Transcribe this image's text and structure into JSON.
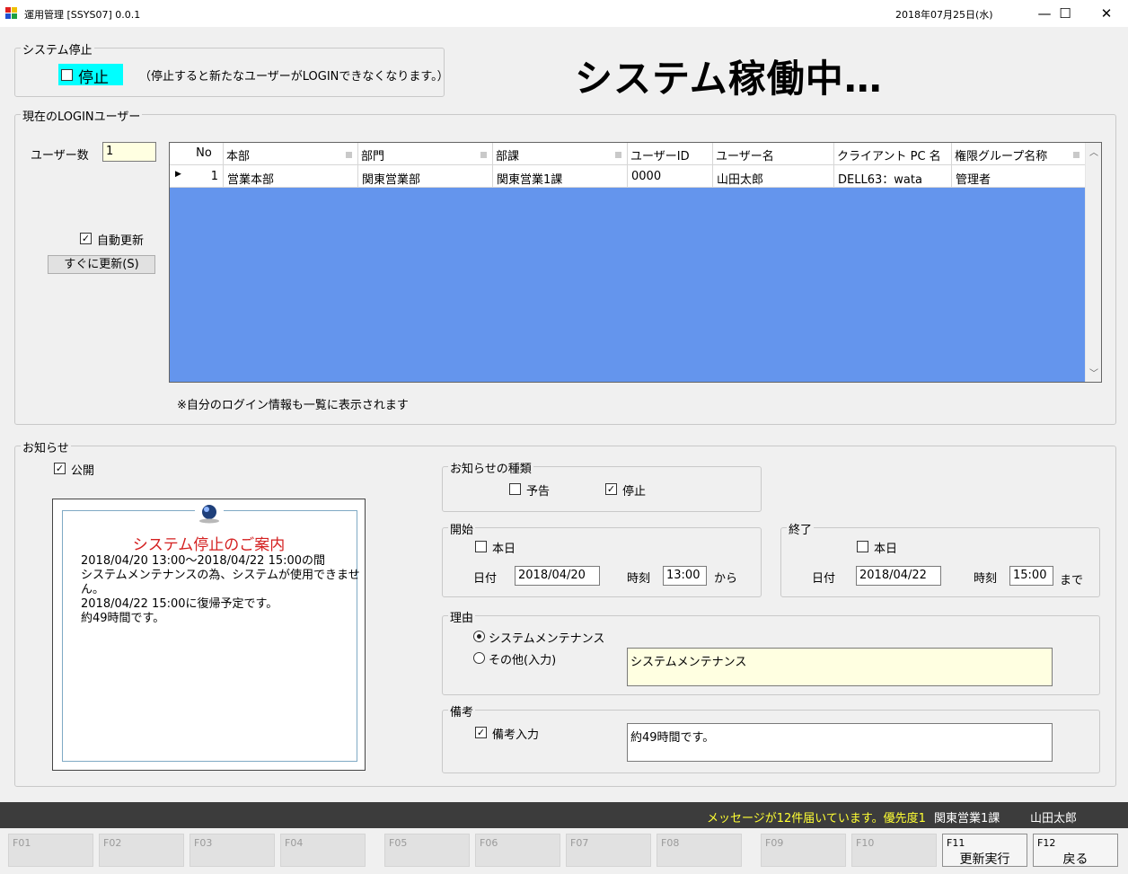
{
  "window": {
    "title": "運用管理 [SSYS07] 0.0.1",
    "date": "2018年07月25日(水)",
    "controls": {
      "minimize": "—",
      "maximize": "☐",
      "close": "✕"
    }
  },
  "system_stop": {
    "legend": "システム停止",
    "checkbox_label": "停止",
    "note": "（停止すると新たなユーザーがLOGINできなくなります。）",
    "status_banner": "システム稼働中…"
  },
  "login_users": {
    "legend": "現在のLOGINユーザー",
    "user_count_label": "ユーザー数",
    "user_count_value": "1",
    "auto_refresh_label": "自動更新",
    "refresh_button": "すぐに更新(S)",
    "columns": [
      "No",
      "本部",
      "部門",
      "部課",
      "ユーザーID",
      "ユーザー名",
      "クライアント PC 名",
      "権限グループ名称"
    ],
    "rows": [
      [
        "1",
        "営業本部",
        "関東営業部",
        "関東営業1課",
        "0000",
        "山田太郎",
        "DELL63：wata",
        "管理者"
      ]
    ],
    "footnote": "※自分のログイン情報も一覧に表示されます"
  },
  "notice": {
    "legend": "お知らせ",
    "publish_label": "公開",
    "preview": {
      "title": "システム停止のご案内",
      "lines": [
        "2018/04/20 13:00～2018/04/22 15:00の間",
        "システムメンテナンスの為、システムが使用できませ",
        "ん。",
        "2018/04/22 15:00に復帰予定です。",
        "約49時間です。"
      ]
    },
    "type": {
      "legend": "お知らせの種類",
      "advance_label": "予告",
      "stop_label": "停止"
    },
    "start": {
      "legend": "開始",
      "today_label": "本日",
      "date_label": "日付",
      "date_value": "2018/04/20",
      "time_label": "時刻",
      "time_value": "13:00",
      "suffix": "から"
    },
    "end": {
      "legend": "終了",
      "today_label": "本日",
      "date_label": "日付",
      "date_value": "2018/04/22",
      "time_label": "時刻",
      "time_value": "15:00",
      "suffix": "まで"
    },
    "reason": {
      "legend": "理由",
      "option_maintenance": "システムメンテナンス",
      "option_other": "その他(入力)",
      "value": "システムメンテナンス"
    },
    "remarks": {
      "legend": "備考",
      "checkbox_label": "備考入力",
      "value": "約49時間です。"
    }
  },
  "statusbar": {
    "message": "メッセージが12件届いています。優先度1",
    "department": "関東営業1課",
    "user": "山田太郎"
  },
  "fkeys": [
    {
      "key": "F01",
      "label": ""
    },
    {
      "key": "F02",
      "label": ""
    },
    {
      "key": "F03",
      "label": ""
    },
    {
      "key": "F04",
      "label": ""
    },
    {
      "key": "F05",
      "label": ""
    },
    {
      "key": "F06",
      "label": ""
    },
    {
      "key": "F07",
      "label": ""
    },
    {
      "key": "F08",
      "label": ""
    },
    {
      "key": "F09",
      "label": ""
    },
    {
      "key": "F10",
      "label": ""
    },
    {
      "key": "F11",
      "label": "更新実行"
    },
    {
      "key": "F12",
      "label": "戻る"
    }
  ],
  "colors": {
    "grid_background": "#6495ed",
    "stop_highlight": "#00ffff",
    "banner_title_red": "#d42020",
    "status_message_yellow": "#ffff33",
    "input_yellow": "#ffffe1"
  }
}
